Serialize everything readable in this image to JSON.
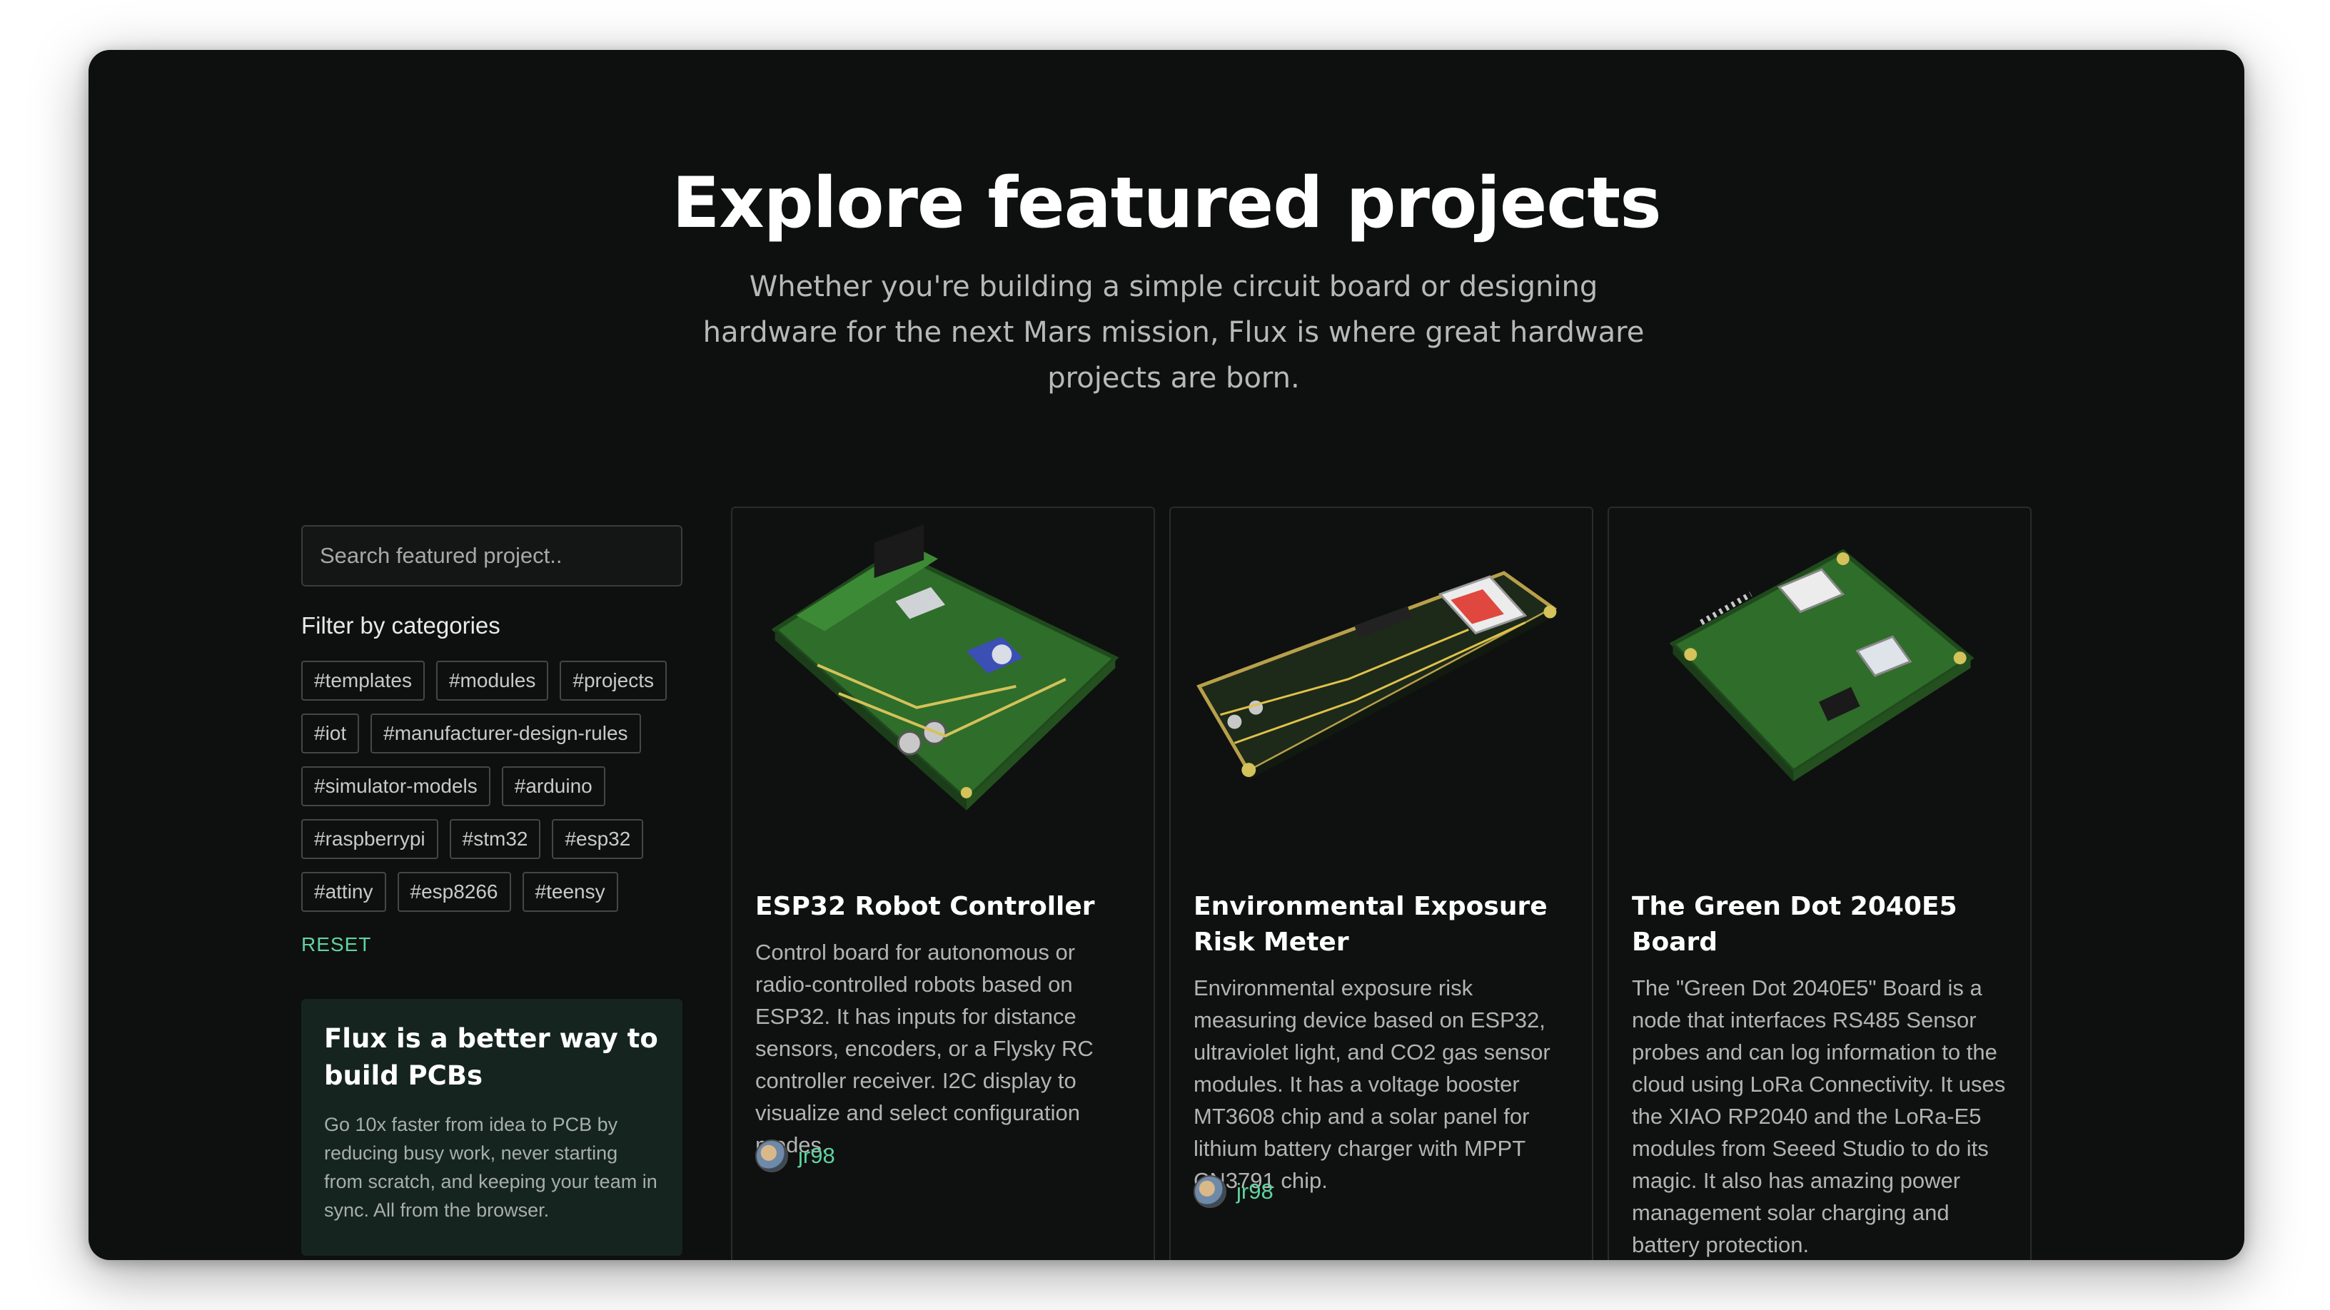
{
  "hero": {
    "title": "Explore featured projects",
    "subtitle": "Whether you're building a simple circuit board or designing hardware for the next Mars mission, Flux is where great hardware projects are born."
  },
  "sidebar": {
    "search_placeholder": "Search featured project..",
    "filter_title": "Filter by categories",
    "tags": [
      "#templates",
      "#modules",
      "#projects",
      "#iot",
      "#manufacturer-design-rules",
      "#simulator-models",
      "#arduino",
      "#raspberrypi",
      "#stm32",
      "#esp32",
      "#attiny",
      "#esp8266",
      "#teensy"
    ],
    "reset_label": "RESET",
    "promo": {
      "title": "Flux is a better way to build PCBs",
      "body": "Go 10x faster from idea to PCB by reducing busy work, never starting from scratch, and keeping your team in sync. All from the browser."
    }
  },
  "cards": [
    {
      "title": "ESP32 Robot Controller",
      "description": "Control board for autonomous or radio-controlled robots based on ESP32. It has inputs for distance sensors, encoders, or a Flysky RC controller receiver. I2C display to visualize and select configuration modes.",
      "author": "jr98"
    },
    {
      "title": "Environmental Exposure Risk Meter",
      "description": "Environmental exposure risk measuring device based on ESP32, ultraviolet light, and CO2 gas sensor modules. It has a voltage booster MT3608 chip and a solar panel for lithium battery charger with MPPT CN3791 chip.",
      "author": "jr98"
    },
    {
      "title": "The Green Dot 2040E5 Board",
      "description": "The \"Green Dot 2040E5\" Board is a node that interfaces RS485 Sensor probes and can log information to the cloud using LoRa Connectivity. It uses the XIAO RP2040 and the LoRa-E5 modules from Seeed Studio to do its magic. It also has amazing power management solar charging and battery protection.",
      "author": ""
    }
  ],
  "colors": {
    "background": "#0e0f0f",
    "accent": "#5fd4a1",
    "pcb_green": "#2f6d2a"
  }
}
